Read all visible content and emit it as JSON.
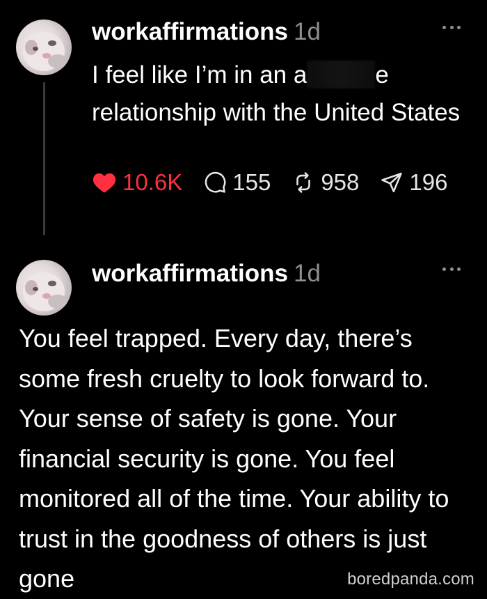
{
  "posts": [
    {
      "username": "workaffirmations",
      "time": "1d",
      "text_before": "I feel like I’m in an a",
      "text_after": "e relationship with the United States",
      "likes": "10.6K",
      "comments": "155",
      "reposts": "958",
      "shares": "196"
    },
    {
      "username": "workaffirmations",
      "time": "1d",
      "text": "You feel trapped. Every day, there’s some fresh cruelty to look forward to. Your sense of safety is gone. Your financial security is gone. You feel monitored all of the time. Your ability to trust in the goodness of others is just gone"
    }
  ],
  "watermark": "boredpanda.com",
  "icons": {
    "like": "heart-icon",
    "comment": "comment-icon",
    "repost": "repost-icon",
    "share": "share-icon",
    "more": "more-icon"
  },
  "colors": {
    "background": "#000000",
    "like": "#ff3040",
    "muted": "#8e8e93"
  }
}
